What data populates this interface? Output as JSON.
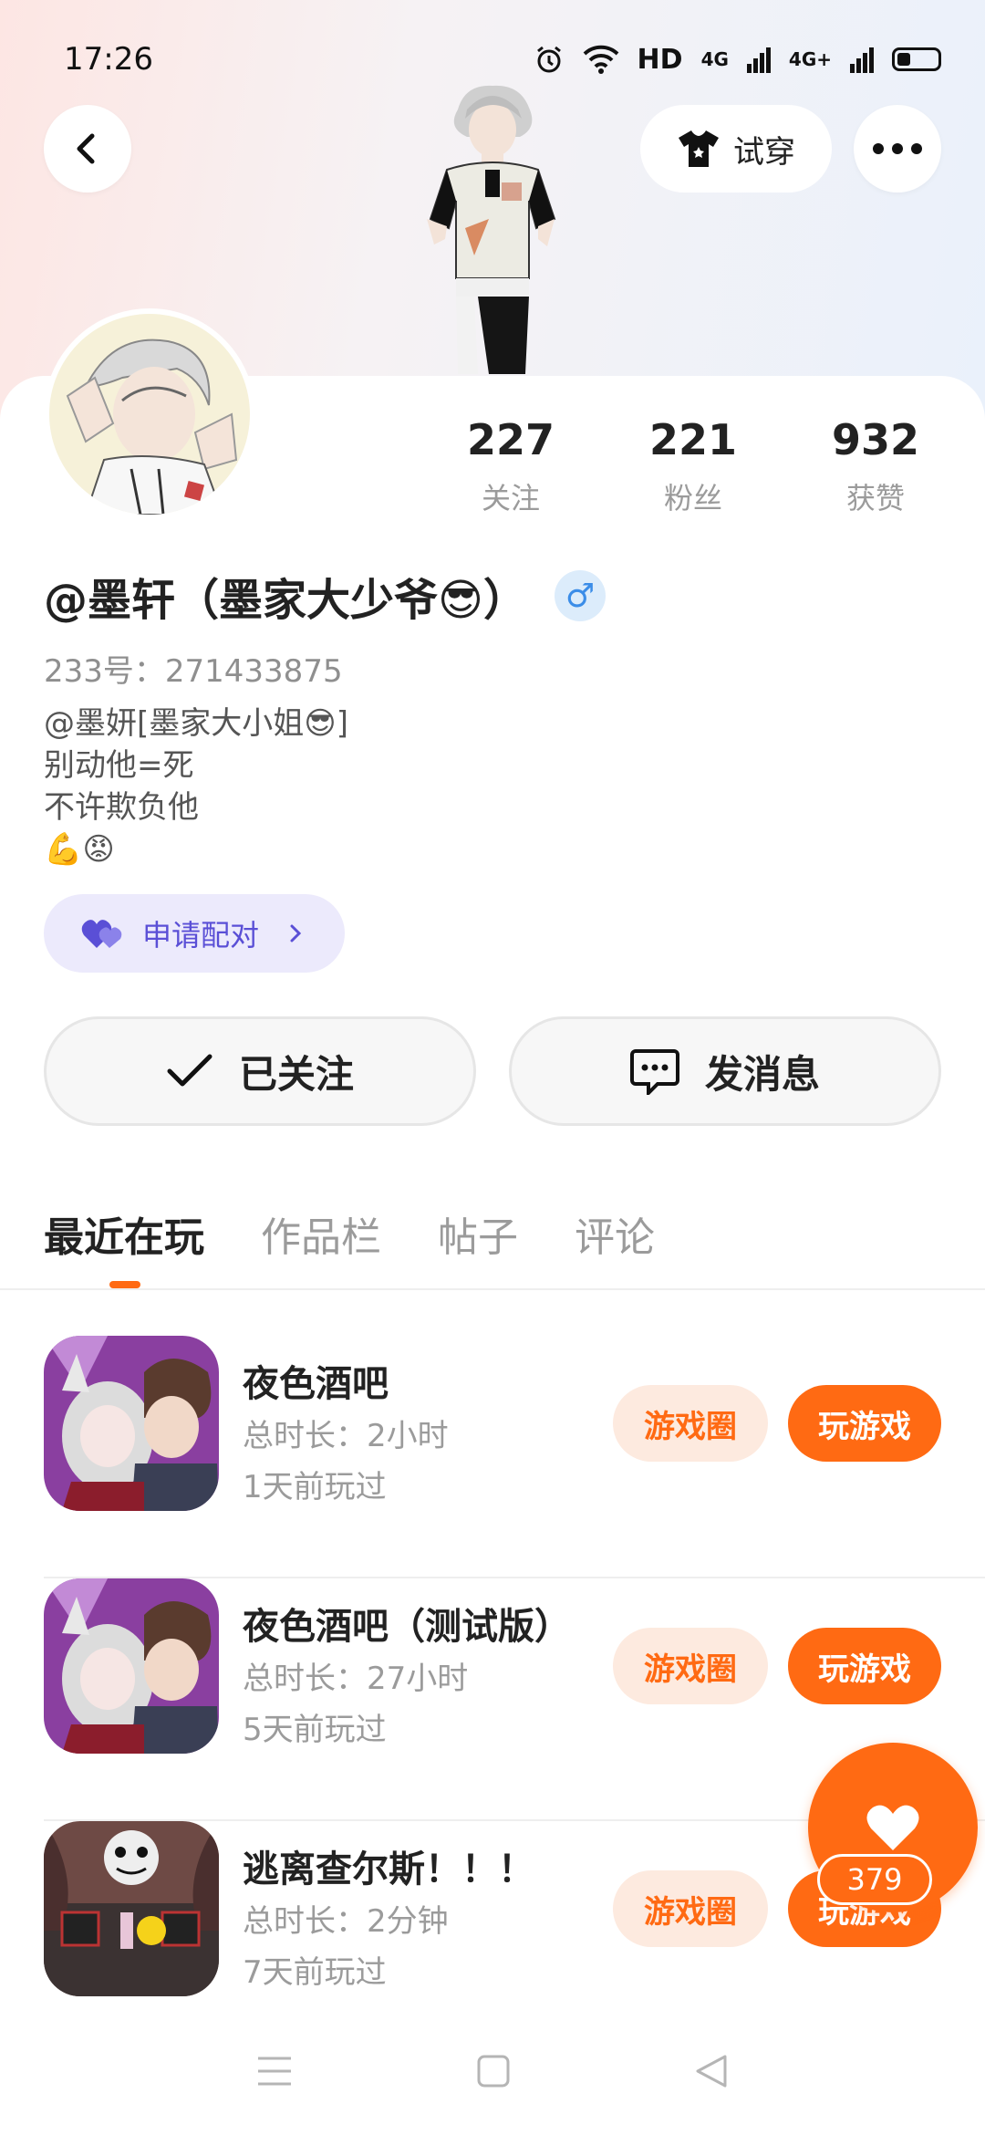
{
  "status_bar": {
    "time": "17:26",
    "network": "HD",
    "signal1": "4G",
    "signal2": "4G+"
  },
  "header": {
    "tryon_label": "试穿"
  },
  "stats": [
    {
      "value": "227",
      "label": "关注"
    },
    {
      "value": "221",
      "label": "粉丝"
    },
    {
      "value": "932",
      "label": "获赞"
    }
  ],
  "profile": {
    "nickname": "@墨轩（墨家大少爷😎）",
    "gender_symbol": "♂",
    "uid": "233号：271433875",
    "bio": [
      "@墨妍[墨家大小姐😎]",
      "别动他=死",
      "不许欺负他",
      "💪😡"
    ]
  },
  "pair_button": {
    "label": "申请配对"
  },
  "actions": {
    "follow_label": "已关注",
    "message_label": "发消息"
  },
  "tabs": [
    "最近在玩",
    "作品栏",
    "帖子",
    "评论"
  ],
  "games": [
    {
      "title": "夜色酒吧",
      "duration": "总时长：2小时",
      "last_played": "1天前玩过",
      "circle_label": "游戏圈",
      "play_label": "玩游戏"
    },
    {
      "title": "夜色酒吧（测试版）",
      "duration": "总时长：27小时",
      "last_played": "5天前玩过",
      "circle_label": "游戏圈",
      "play_label": "玩游戏"
    },
    {
      "title": "逃离查尔斯！！！",
      "duration": "总时长：2分钟",
      "last_played": "7天前玩过",
      "circle_label": "游戏圈",
      "play_label": "玩游戏"
    }
  ],
  "fab": {
    "count": "379"
  },
  "colors": {
    "accent": "#ff6a13",
    "accent_light": "#fdeadf",
    "pair_bg": "#eceafc",
    "pair_text": "#5a4fd6"
  }
}
